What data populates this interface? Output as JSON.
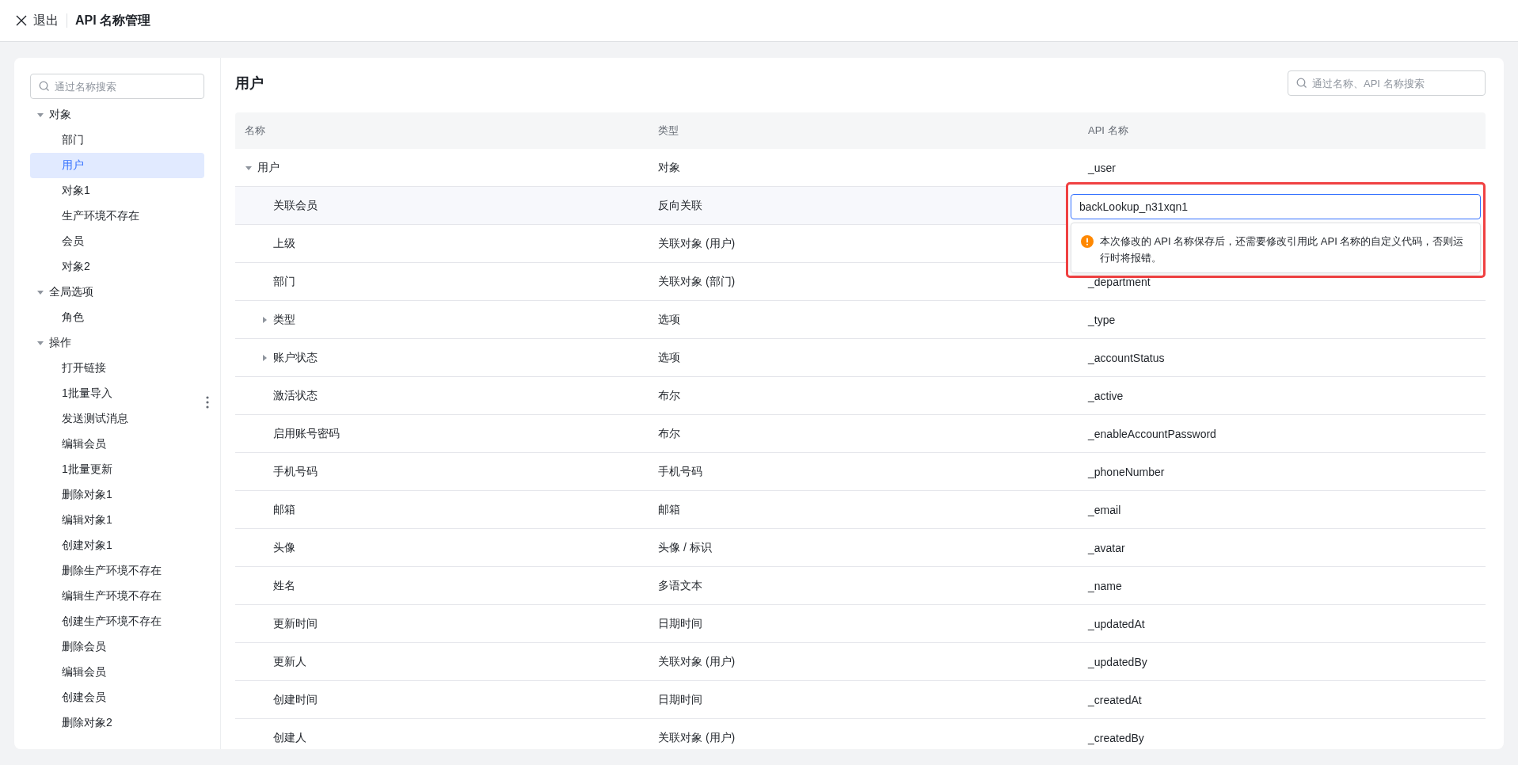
{
  "header": {
    "exit_label": "退出",
    "title": "API 名称管理"
  },
  "sidebar": {
    "search": {
      "placeholder": "通过名称搜索"
    },
    "groups": [
      {
        "label": "对象",
        "expanded": true,
        "children": [
          {
            "label": "部门",
            "selected": false
          },
          {
            "label": "用户",
            "selected": true
          },
          {
            "label": "对象1",
            "selected": false
          },
          {
            "label": "生产环境不存在",
            "selected": false
          },
          {
            "label": "会员",
            "selected": false
          },
          {
            "label": "对象2",
            "selected": false
          }
        ]
      },
      {
        "label": "全局选项",
        "expanded": true,
        "children": [
          {
            "label": "角色",
            "selected": false
          }
        ]
      },
      {
        "label": "操作",
        "expanded": true,
        "children": [
          {
            "label": "打开链接",
            "selected": false
          },
          {
            "label": "1批量导入",
            "selected": false
          },
          {
            "label": "发送测试消息",
            "selected": false
          },
          {
            "label": "编辑会员",
            "selected": false
          },
          {
            "label": "1批量更新",
            "selected": false
          },
          {
            "label": "删除对象1",
            "selected": false
          },
          {
            "label": "编辑对象1",
            "selected": false
          },
          {
            "label": "创建对象1",
            "selected": false
          },
          {
            "label": "删除生产环境不存在",
            "selected": false
          },
          {
            "label": "编辑生产环境不存在",
            "selected": false
          },
          {
            "label": "创建生产环境不存在",
            "selected": false
          },
          {
            "label": "删除会员",
            "selected": false
          },
          {
            "label": "编辑会员",
            "selected": false
          },
          {
            "label": "创建会员",
            "selected": false
          },
          {
            "label": "删除对象2",
            "selected": false
          }
        ]
      }
    ]
  },
  "main": {
    "title": "用户",
    "search": {
      "placeholder": "通过名称、API 名称搜索"
    },
    "table": {
      "columns": [
        "名称",
        "类型",
        "API 名称"
      ],
      "rows": [
        {
          "name": "用户",
          "type": "对象",
          "api": "_user",
          "expanded": true,
          "children": [
            {
              "name": "关联会员",
              "type": "反向关联",
              "highlighted": true,
              "editor": {
                "value": "backLookup_n31xqn1",
                "warning": "本次修改的 API 名称保存后，还需要修改引用此 API 名称的自定义代码，否则运行时将报错。",
                "annotated": true
              }
            },
            {
              "name": "上级",
              "type": "关联对象 (用户)"
            },
            {
              "name": "部门",
              "type": "关联对象 (部门)",
              "api": "_department"
            },
            {
              "name": "类型",
              "type": "选项",
              "api": "_type",
              "expanded": false
            },
            {
              "name": "账户状态",
              "type": "选项",
              "api": "_accountStatus",
              "expanded": false
            },
            {
              "name": "激活状态",
              "type": "布尔",
              "api": "_active"
            },
            {
              "name": "启用账号密码",
              "type": "布尔",
              "api": "_enableAccountPassword"
            },
            {
              "name": "手机号码",
              "type": "手机号码",
              "api": "_phoneNumber"
            },
            {
              "name": "邮箱",
              "type": "邮箱",
              "api": "_email"
            },
            {
              "name": "头像",
              "type": "头像 / 标识",
              "api": "_avatar"
            },
            {
              "name": "姓名",
              "type": "多语文本",
              "api": "_name"
            },
            {
              "name": "更新时间",
              "type": "日期时间",
              "api": "_updatedAt"
            },
            {
              "name": "更新人",
              "type": "关联对象 (用户)",
              "api": "_updatedBy"
            },
            {
              "name": "创建时间",
              "type": "日期时间",
              "api": "_createdAt"
            },
            {
              "name": "创建人",
              "type": "关联对象 (用户)",
              "api": "_createdBy"
            }
          ]
        }
      ]
    }
  }
}
